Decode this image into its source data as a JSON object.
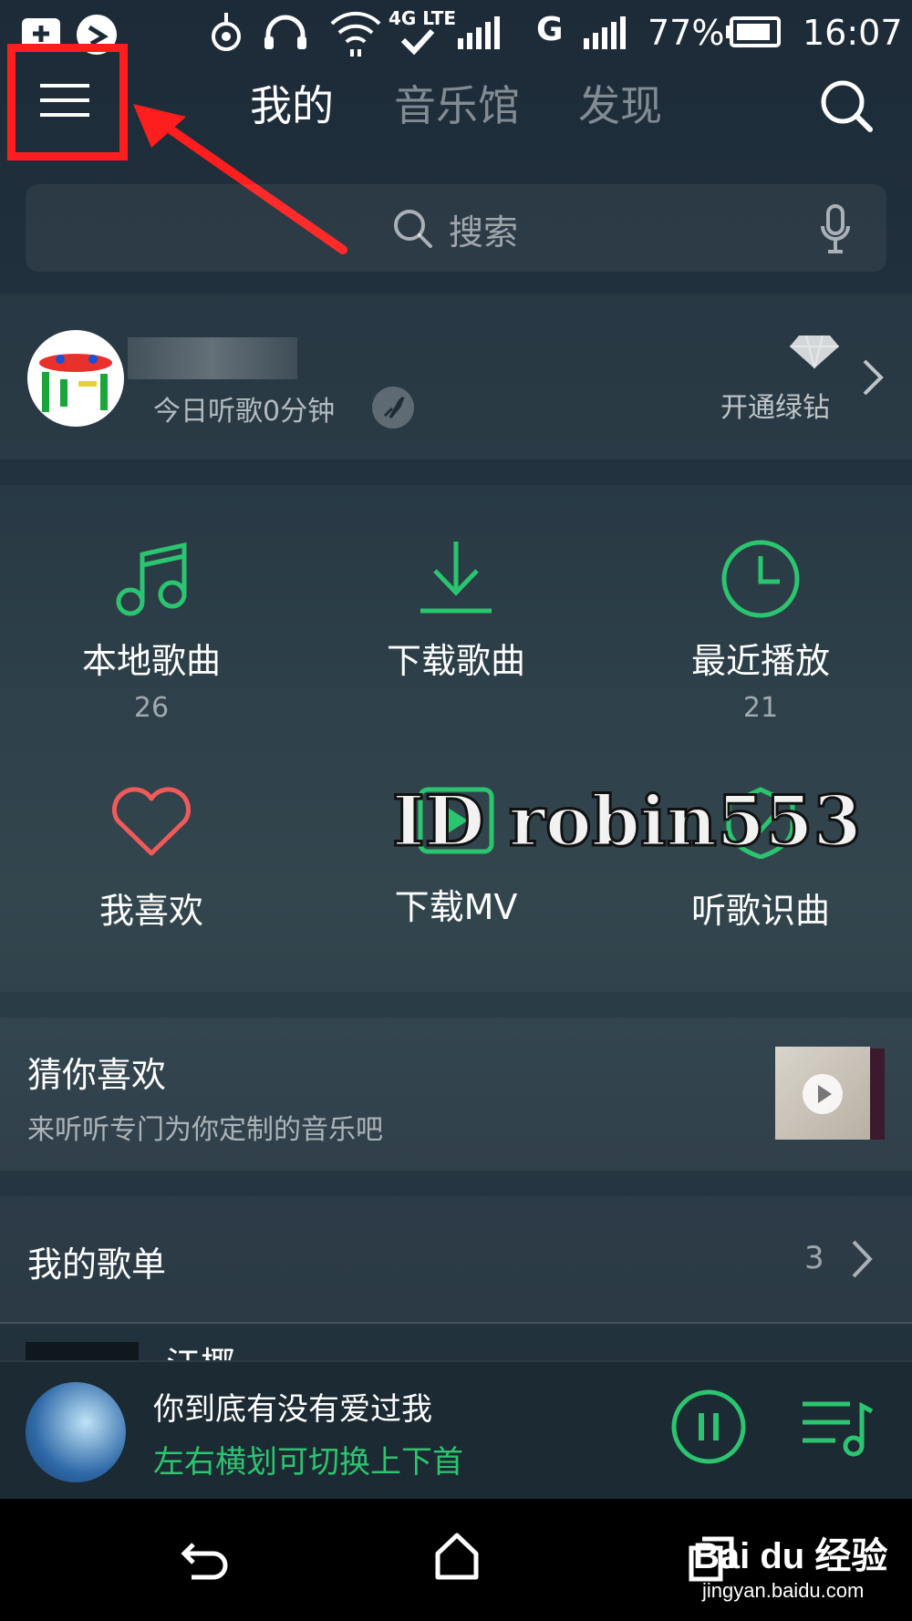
{
  "status": {
    "network": "4G LTE",
    "carrier_g": "G",
    "battery": "77%",
    "time": "16:07"
  },
  "nav": {
    "tabs": [
      "我的",
      "音乐馆",
      "发现"
    ]
  },
  "search": {
    "placeholder": "搜索"
  },
  "profile": {
    "listen_time": "今日听歌0分钟",
    "vip_label": "开通绿钻"
  },
  "features": [
    {
      "label": "本地歌曲",
      "count": "26",
      "icon": "music-note-icon"
    },
    {
      "label": "下载歌曲",
      "count": "",
      "icon": "download-icon"
    },
    {
      "label": "最近播放",
      "count": "21",
      "icon": "clock-icon"
    },
    {
      "label": "我喜欢",
      "count": "",
      "icon": "heart-icon"
    },
    {
      "label": "下载MV",
      "count": "",
      "icon": "mv-download-icon"
    },
    {
      "label": "听歌识曲",
      "count": "",
      "icon": "recognize-song-icon"
    }
  ],
  "guess": {
    "title": "猜你喜欢",
    "subtitle": "来听听专门为你定制的音乐吧"
  },
  "playlists": {
    "title": "我的歌单",
    "count": "3",
    "first_item_partial": "江椰"
  },
  "player": {
    "song": "你到底有没有爱过我",
    "hint": "左右横划可切换上下首"
  },
  "watermarks": {
    "id": "ID robin553",
    "baidu": "Bai du 经验",
    "baidu_url": "jingyan.baidu.com"
  },
  "colors": {
    "accent": "#2bc56f",
    "annotation": "#ff1e1e"
  }
}
